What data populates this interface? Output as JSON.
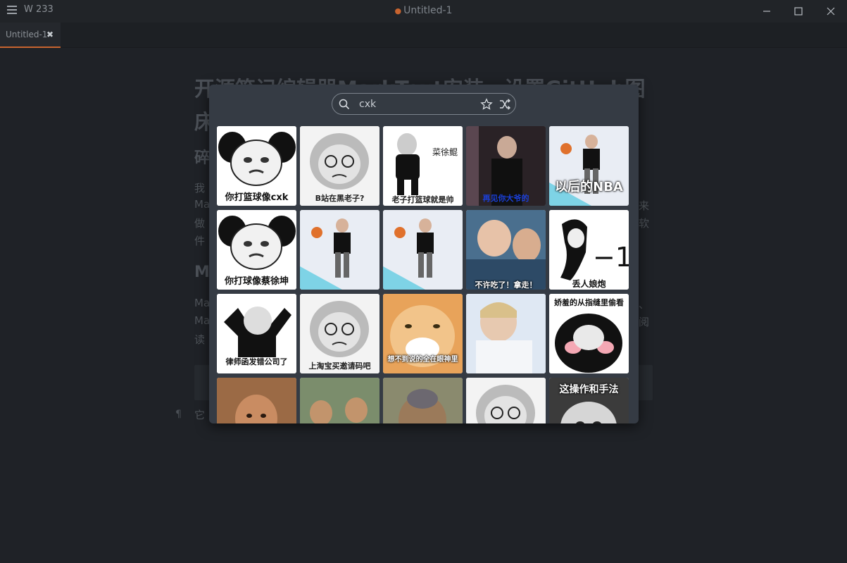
{
  "titlebar": {
    "word_count": "W 233",
    "dot": "●",
    "title": "Untitled-1"
  },
  "tab": {
    "label": "Untitled-1",
    "close": "✖"
  },
  "doc": {
    "h1_line1": "开源笔记编辑器MarkText安装，设置GitHub图",
    "h1_line2": "床",
    "h2_a": "碎",
    "para1": [
      "我",
      "Ma",
      "做",
      "件"
    ],
    "para1_right": [
      "来",
      "软"
    ],
    "h2_b": "M",
    "para2": [
      "Ma",
      "Ma",
      "读"
    ],
    "para2_right": [
      "、",
      "阅"
    ],
    "pilcrow": "¶",
    "last_line": "它"
  },
  "picker": {
    "search_value": "cxk",
    "stickers": [
      {
        "caption": "你打篮球像cxk",
        "style": "panda"
      },
      {
        "caption": "B站在黑老子?",
        "style": "face"
      },
      {
        "caption": "老子打篮球就是帅",
        "style": "dancer",
        "side_text": "菜徐鲲"
      },
      {
        "caption": "再见你大爷的",
        "style": "photo-dark"
      },
      {
        "caption": "以后的NBA",
        "style": "photo-court"
      },
      {
        "caption": "你打球像蔡徐坤",
        "style": "panda"
      },
      {
        "caption": "",
        "style": "photo-court"
      },
      {
        "caption": "",
        "style": "photo-court"
      },
      {
        "caption": "不许吃了！拿走！",
        "style": "photo-crowd"
      },
      {
        "caption": "丢人娘炮",
        "style": "panda-minus",
        "side_text": "−1"
      },
      {
        "caption": "律师函发错公司了",
        "style": "lawyer"
      },
      {
        "caption": "上淘宝买邀请码吧",
        "style": "face"
      },
      {
        "caption": "想不到说的全在眼神里",
        "style": "cat"
      },
      {
        "caption": "",
        "style": "photo-light"
      },
      {
        "caption": "娇羞的从指缝里偷看",
        "style": "panda-shy"
      },
      {
        "caption": "",
        "style": "photo-warm"
      },
      {
        "caption": "",
        "style": "photo-street"
      },
      {
        "caption": "",
        "style": "photo-monkey"
      },
      {
        "caption": "",
        "style": "face"
      },
      {
        "caption": "这操作和手法",
        "style": "panda-dark"
      }
    ]
  },
  "colors": {
    "accent": "#c8642f",
    "picker_bg": "#353b44",
    "editor_bg": "#1f2227"
  }
}
